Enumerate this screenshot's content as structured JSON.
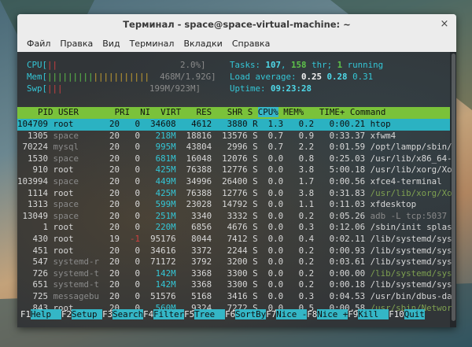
{
  "window": {
    "title": "Терминал - space@space-virtual-machine: ~",
    "close_glyph": "×"
  },
  "menu": [
    "Файл",
    "Правка",
    "Вид",
    "Терминал",
    "Вкладки",
    "Справка"
  ],
  "meters": {
    "cpu_label": "CPU[",
    "cpu_value": "2.0%]",
    "mem_label": "Mem[",
    "mem_value": "468M/1.92G]",
    "swp_label": "Swp[",
    "swp_value": "199M/923M]",
    "tasks_label": "Tasks: ",
    "tasks": "107",
    "thr": "158",
    "thr_label": " thr; ",
    "running": "1",
    "running_label": " running",
    "load_label": "Load average: ",
    "load1": "0.25",
    "load5": "0.28",
    "load15": "0.31",
    "uptime_label": "Uptime: ",
    "uptime": "09:23:28"
  },
  "columns": [
    "PID",
    "USER",
    "PRI",
    "NI",
    "VIRT",
    "RES",
    "SHR",
    "S",
    "CPU%",
    "MEM%",
    "TIME+",
    "Command"
  ],
  "processes": [
    {
      "pid": "104709",
      "user": "root",
      "pri": "20",
      "ni": "0",
      "virt": "34608",
      "res": "4612",
      "shr": "3880",
      "s": "R",
      "cpu": "1.3",
      "mem": "0.2",
      "time": "0:00.21",
      "cmd": "htop"
    },
    {
      "pid": "1305",
      "user": "space",
      "pri": "20",
      "ni": "0",
      "virt": "218M",
      "res": "18816",
      "shr": "13576",
      "s": "S",
      "cpu": "0.7",
      "mem": "0.9",
      "time": "0:33.37",
      "cmd": "xfwm4"
    },
    {
      "pid": "70224",
      "user": "mysql",
      "pri": "20",
      "ni": "0",
      "virt": "995M",
      "res": "43804",
      "shr": "2996",
      "s": "S",
      "cpu": "0.7",
      "mem": "2.2",
      "time": "0:01.59",
      "cmd": "/opt/lampp/sbin/"
    },
    {
      "pid": "1530",
      "user": "space",
      "pri": "20",
      "ni": "0",
      "virt": "681M",
      "res": "16048",
      "shr": "12076",
      "s": "S",
      "cpu": "0.0",
      "mem": "0.8",
      "time": "0:25.03",
      "cmd": "/usr/lib/x86_64-"
    },
    {
      "pid": "910",
      "user": "root",
      "pri": "20",
      "ni": "0",
      "virt": "425M",
      "res": "76388",
      "shr": "12776",
      "s": "S",
      "cpu": "0.0",
      "mem": "3.8",
      "time": "5:00.18",
      "cmd": "/usr/lib/xorg/Xo"
    },
    {
      "pid": "103994",
      "user": "space",
      "pri": "20",
      "ni": "0",
      "virt": "449M",
      "res": "34996",
      "shr": "26400",
      "s": "S",
      "cpu": "0.0",
      "mem": "1.7",
      "time": "0:00.56",
      "cmd": "xfce4-terminal"
    },
    {
      "pid": "1114",
      "user": "root",
      "pri": "20",
      "ni": "0",
      "virt": "425M",
      "res": "76388",
      "shr": "12776",
      "s": "S",
      "cpu": "0.0",
      "mem": "3.8",
      "time": "0:31.83",
      "cmd": "/usr/lib/xorg/Xo"
    },
    {
      "pid": "1313",
      "user": "space",
      "pri": "20",
      "ni": "0",
      "virt": "599M",
      "res": "23028",
      "shr": "14792",
      "s": "S",
      "cpu": "0.0",
      "mem": "1.1",
      "time": "0:11.03",
      "cmd": "xfdesktop"
    },
    {
      "pid": "13049",
      "user": "space",
      "pri": "20",
      "ni": "0",
      "virt": "251M",
      "res": "3340",
      "shr": "3332",
      "s": "S",
      "cpu": "0.0",
      "mem": "0.2",
      "time": "0:05.26",
      "cmd": "adb -L tcp:5037"
    },
    {
      "pid": "1",
      "user": "root",
      "pri": "20",
      "ni": "0",
      "virt": "220M",
      "res": "6856",
      "shr": "4676",
      "s": "S",
      "cpu": "0.0",
      "mem": "0.3",
      "time": "0:12.06",
      "cmd": "/sbin/init splas"
    },
    {
      "pid": "430",
      "user": "root",
      "pri": "19",
      "ni": "-1",
      "virt": "95176",
      "res": "8044",
      "shr": "7412",
      "s": "S",
      "cpu": "0.0",
      "mem": "0.4",
      "time": "0:02.11",
      "cmd": "/lib/systemd/sys"
    },
    {
      "pid": "451",
      "user": "root",
      "pri": "20",
      "ni": "0",
      "virt": "34616",
      "res": "3372",
      "shr": "2244",
      "s": "S",
      "cpu": "0.0",
      "mem": "0.2",
      "time": "0:00.93",
      "cmd": "/lib/systemd/sys"
    },
    {
      "pid": "547",
      "user": "systemd-r",
      "pri": "20",
      "ni": "0",
      "virt": "71172",
      "res": "3792",
      "shr": "3200",
      "s": "S",
      "cpu": "0.0",
      "mem": "0.2",
      "time": "0:03.61",
      "cmd": "/lib/systemd/sys"
    },
    {
      "pid": "726",
      "user": "systemd-t",
      "pri": "20",
      "ni": "0",
      "virt": "142M",
      "res": "3368",
      "shr": "3300",
      "s": "S",
      "cpu": "0.0",
      "mem": "0.2",
      "time": "0:00.00",
      "cmd": "/lib/systemd/sys"
    },
    {
      "pid": "651",
      "user": "systemd-t",
      "pri": "20",
      "ni": "0",
      "virt": "142M",
      "res": "3368",
      "shr": "3300",
      "s": "S",
      "cpu": "0.0",
      "mem": "0.2",
      "time": "0:00.18",
      "cmd": "/lib/systemd/sys"
    },
    {
      "pid": "725",
      "user": "messagebu",
      "pri": "20",
      "ni": "0",
      "virt": "51576",
      "res": "5168",
      "shr": "3416",
      "s": "S",
      "cpu": "0.0",
      "mem": "0.3",
      "time": "0:04.53",
      "cmd": "/usr/bin/dbus-da"
    },
    {
      "pid": "843",
      "user": "root",
      "pri": "20",
      "ni": "0",
      "virt": "560M",
      "res": "9324",
      "shr": "7272",
      "s": "S",
      "cpu": "0.0",
      "mem": "0.5",
      "time": "0:00.58",
      "cmd": "/usr/sbin/Networ"
    }
  ],
  "fkeys": [
    {
      "key": "F1",
      "label": "Help  "
    },
    {
      "key": "F2",
      "label": "Setup "
    },
    {
      "key": "F3",
      "label": "Search"
    },
    {
      "key": "F4",
      "label": "Filter"
    },
    {
      "key": "F5",
      "label": "Tree  "
    },
    {
      "key": "F6",
      "label": "SortBy"
    },
    {
      "key": "F7",
      "label": "Nice -"
    },
    {
      "key": "F8",
      "label": "Nice +"
    },
    {
      "key": "F9",
      "label": "Kill  "
    },
    {
      "key": "F10",
      "label": "Quit"
    }
  ],
  "colors": {
    "header_bg": "#7ac23a",
    "sort_col_bg": "#37b7c8",
    "selected_bg": "#2bb2c2",
    "accent_cyan": "#34c6d6"
  }
}
